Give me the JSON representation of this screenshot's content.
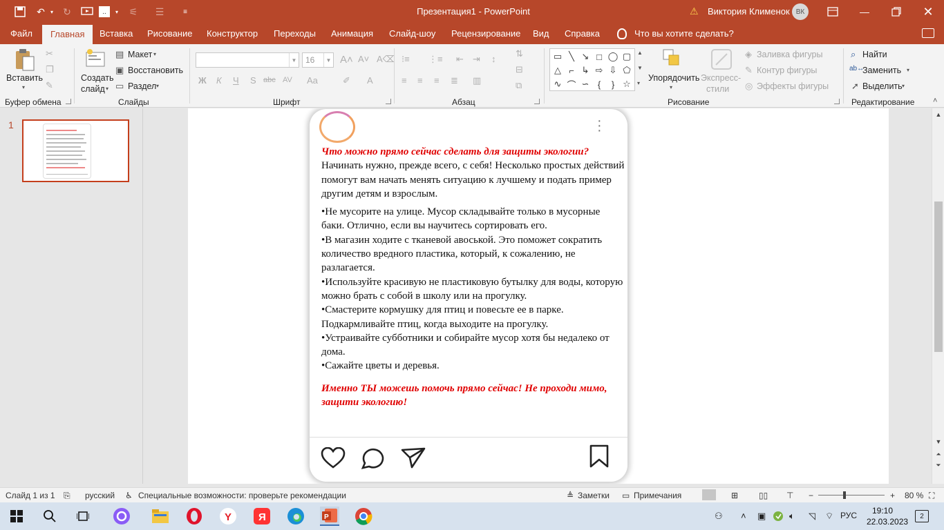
{
  "window": {
    "doc_title": "Презентация1 - PowerPoint",
    "user_name": "Виктория Клименок",
    "user_initials": "ВК",
    "qat_font_box": ".."
  },
  "tabs": [
    "Файл",
    "Главная",
    "Вставка",
    "Рисование",
    "Конструктор",
    "Переходы",
    "Анимация",
    "Слайд-шоу",
    "Рецензирование",
    "Вид",
    "Справка"
  ],
  "tell_me": "Что вы хотите сделать?",
  "ribbon": {
    "clipboard": {
      "paste": "Вставить",
      "label": "Буфер обмена"
    },
    "slides": {
      "new_slide_1": "Создать",
      "new_slide_2": "слайд",
      "layout": "Макет",
      "reset": "Восстановить",
      "section": "Раздел",
      "label": "Слайды"
    },
    "font": {
      "font_name": "",
      "font_size": "16",
      "label": "Шрифт",
      "bold": "Ж",
      "italic": "К",
      "underline": "Ч",
      "shadow": "S",
      "strike": "abc",
      "spacing": "AV",
      "case": "Aa",
      "color": "A"
    },
    "paragraph": {
      "label": "Абзац"
    },
    "drawing": {
      "arrange_1": "Упорядочить",
      "quick_styles_1": "Экспресс-",
      "quick_styles_2": "стили",
      "fill": "Заливка фигуры",
      "outline": "Контур фигуры",
      "effects": "Эффекты фигуры",
      "label": "Рисование"
    },
    "editing": {
      "find": "Найти",
      "replace": "Заменить",
      "select": "Выделить",
      "label": "Редактирование"
    }
  },
  "thumbnails": {
    "slide_number": "1"
  },
  "post": {
    "heading": "Что можно прямо сейчас сделать для защиты экологии?",
    "intro": "Начинать нужно, прежде всего, с себя! Несколько простых действий помогут вам начать менять ситуацию к лучшему и подать пример другим детям и взрослым.",
    "items": [
      "•Не мусорите на улице. Мусор складывайте только в мусорные баки. Отлично, если вы научитесь сортировать его.",
      "•В магазин ходите с тканевой авоськой. Это поможет сократить количество вредного пластика, который, к сожалению, не разлагается.",
      "•Используйте красивую не пластиковую бутылку для воды, которую можно брать с собой в школу или на прогулку.",
      "•Смастерите кормушку для птиц и повесьте ее в парке. Подкармливайте птиц, когда выходите на прогулку.",
      "•Устраивайте субботники и собирайте мусор хотя бы недалеко от дома.",
      "•Сажайте цветы и деревья."
    ],
    "closing": "Именно ТЫ можешь помочь прямо сейчас! Не проходи мимо, защити экологию!"
  },
  "status": {
    "slide_info": "Слайд 1 из 1",
    "language": "русский",
    "accessibility": "Специальные возможности: проверьте рекомендации",
    "notes": "Заметки",
    "comments": "Примечания",
    "zoom": "80 %"
  },
  "taskbar": {
    "lang": "РУС",
    "time": "19:10",
    "date": "22.03.2023",
    "notifications": "2"
  },
  "colors": {
    "accent": "#b7472a",
    "heading_red": "#e00000",
    "taskbar": "#d7e2ee"
  }
}
